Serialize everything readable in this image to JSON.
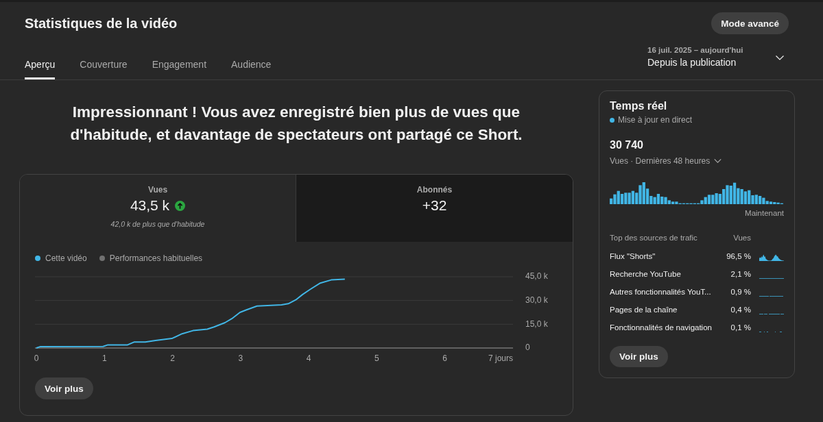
{
  "header": {
    "title": "Statistiques de la vidéo",
    "mode_button": "Mode avancé",
    "tabs": [
      {
        "label": "Aperçu",
        "selected": true
      },
      {
        "label": "Couverture",
        "selected": false
      },
      {
        "label": "Engagement",
        "selected": false
      },
      {
        "label": "Audience",
        "selected": false
      }
    ],
    "date_range": {
      "range": "16 juil. 2025 – aujourd'hui",
      "label": "Depuis la publication"
    }
  },
  "overview": {
    "headline": "Impressionnant ! Vous avez enregistré bien plus de vues que d'habitude, et davantage de spectateurs ont partagé ce Short.",
    "stats": [
      {
        "label": "Vues",
        "value": "43,5 k",
        "above_usual": true,
        "note": "42,0 k de plus que d'habitude",
        "selected": true
      },
      {
        "label": "Abonnés",
        "value": "+32",
        "selected": false
      }
    ],
    "chart": {
      "chart_data": {
        "type": "line",
        "x": [
          0,
          0.06,
          0.98,
          1.05,
          1.34,
          1.44,
          1.6,
          1.75,
          1.99,
          2.14,
          2.3,
          2.51,
          2.61,
          2.77,
          2.87,
          2.99,
          3.08,
          3.24,
          3.6,
          3.7,
          3.81,
          3.91,
          4.02,
          4.17,
          4.33,
          4.53
        ],
        "series": [
          {
            "name": "Cette vidéo",
            "color": "#41b6e6",
            "values": [
              0,
              900,
              1000,
              2000,
              2000,
              3800,
              3800,
              4700,
              6000,
              9000,
              11000,
              11900,
              13300,
              16000,
              18500,
              22500,
              24000,
              26500,
              27200,
              28000,
              30400,
              33800,
              37000,
              41000,
              43000,
              43500
            ]
          },
          {
            "name": "Performances habituelles",
            "color": "#717171",
            "values": [
              null,
              null,
              null,
              null,
              null,
              null,
              null,
              null,
              null,
              null,
              null,
              null,
              null,
              null,
              null,
              null,
              null,
              null,
              null,
              null,
              null,
              null,
              null,
              null,
              null,
              null
            ]
          }
        ],
        "xlim": [
          0,
          7
        ],
        "ylim": [
          0,
          45000
        ],
        "xticks": [
          0,
          1,
          2,
          3,
          4,
          5,
          6,
          {
            "value": 7,
            "label": "7 jours"
          }
        ],
        "yticks": [
          0,
          {
            "value": 15000,
            "label": "15,0 k"
          },
          {
            "value": 30000,
            "label": "30,0 k"
          },
          {
            "value": 45000,
            "label": "45,0 k"
          }
        ]
      }
    },
    "button": "Voir plus"
  },
  "realtime": {
    "title": "Temps réel",
    "status": "Mise à jour en direct",
    "count": "30 740",
    "metric": "Vues · Dernières 48 heures",
    "axis_label": "Maintenant",
    "sources_header": "Top des sources de trafic",
    "views_header": "Vues",
    "sources": [
      {
        "name": "Flux \"Shorts\"",
        "share": "96,5 %"
      },
      {
        "name": "Recherche YouTube",
        "share": "2,1 %"
      },
      {
        "name": "Autres fonctionnalités YouT...",
        "share": "0,9 %"
      },
      {
        "name": "Pages de la chaîne",
        "share": "0,4 %"
      },
      {
        "name": "Fonctionnalités de navigation",
        "share": "0,1 %"
      }
    ],
    "button": "Voir plus"
  }
}
